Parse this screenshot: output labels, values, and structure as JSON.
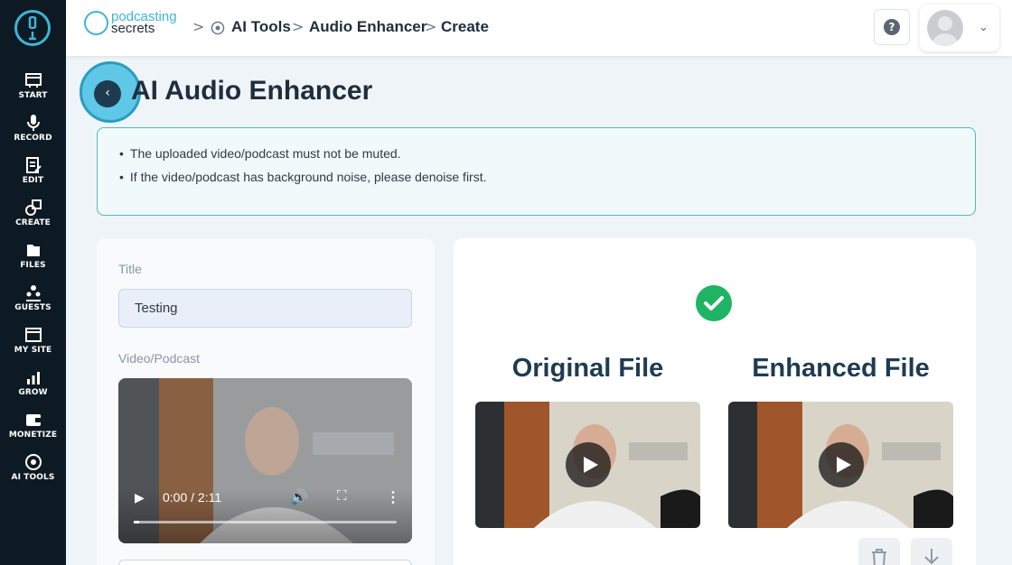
{
  "sidebar": {
    "items": [
      {
        "label": "START",
        "icon": "start-icon"
      },
      {
        "label": "RECORD",
        "icon": "microphone-icon"
      },
      {
        "label": "EDIT",
        "icon": "edit-icon"
      },
      {
        "label": "CREATE",
        "icon": "create-icon"
      },
      {
        "label": "FILES",
        "icon": "files-icon"
      },
      {
        "label": "GUESTS",
        "icon": "guests-icon"
      },
      {
        "label": "MY SITE",
        "icon": "my-site-icon"
      },
      {
        "label": "GROW",
        "icon": "grow-icon"
      },
      {
        "label": "MONETIZE",
        "icon": "monetize-icon"
      },
      {
        "label": "AI TOOLS",
        "icon": "ai-tools-icon"
      }
    ]
  },
  "header": {
    "brand_line1": "podcasting",
    "brand_line2": "secrets",
    "breadcrumb": [
      "AI Tools",
      "Audio Enhancer",
      "Create"
    ],
    "help_label": "?"
  },
  "page": {
    "title": "AI Audio Enhancer",
    "notices": [
      "The uploaded video/podcast must not be muted.",
      "If the video/podcast has background noise, please denoise first."
    ]
  },
  "form": {
    "title_label": "Title",
    "title_value": "Testing",
    "video_label": "Video/Podcast",
    "player_time": "0:00 / 2:11"
  },
  "result": {
    "original_heading": "Original File",
    "enhanced_heading": "Enhanced File"
  },
  "colors": {
    "sidebar_bg": "#0d1a24",
    "accent": "#3fb4d6",
    "success": "#1fb464"
  }
}
